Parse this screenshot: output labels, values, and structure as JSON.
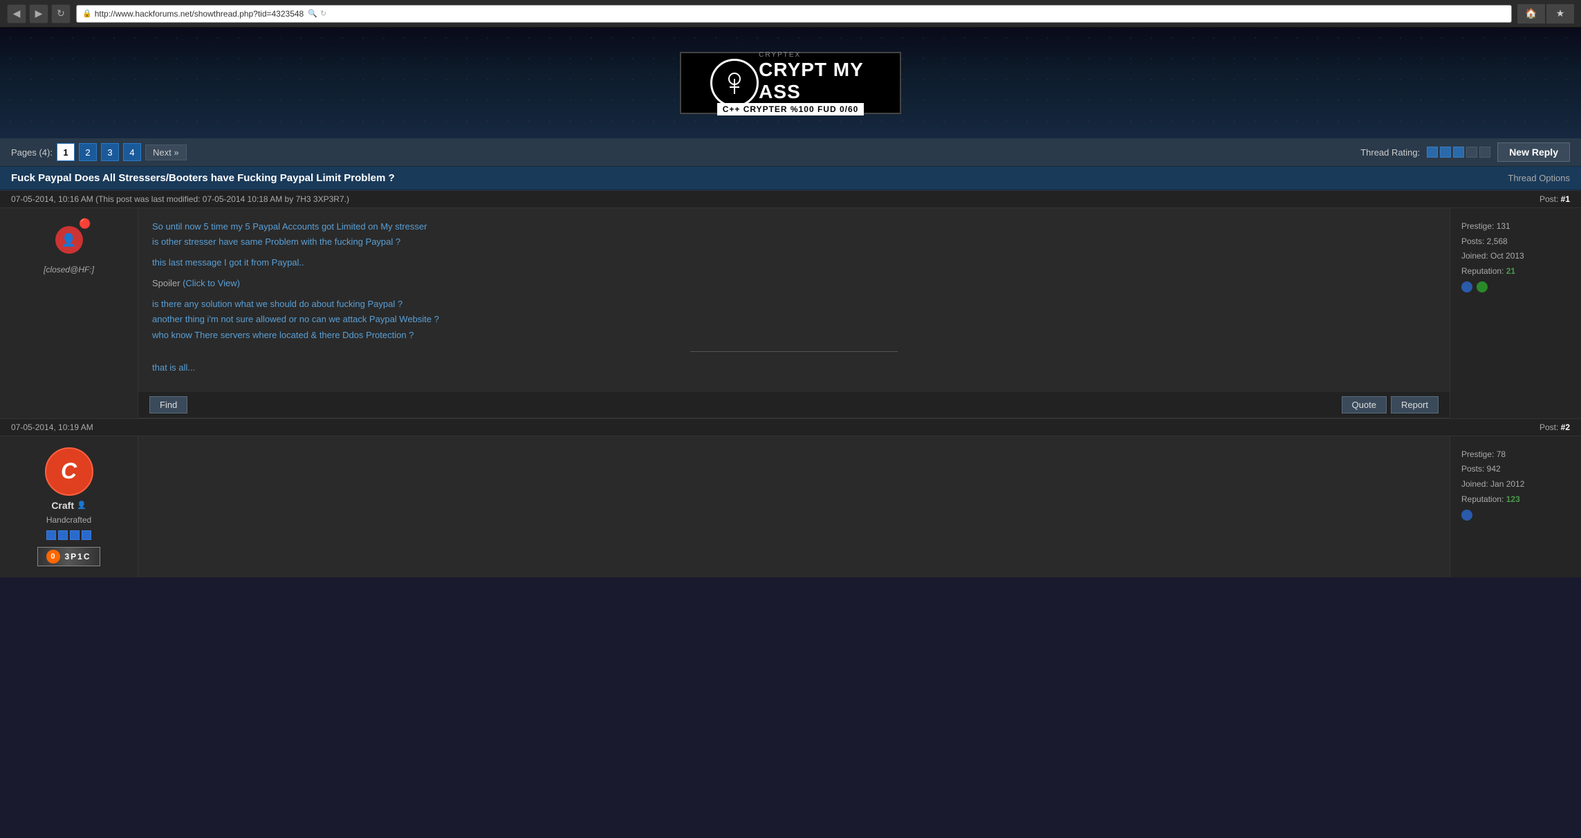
{
  "browser": {
    "url": "http://www.hackforums.net/showthread.php?tid=4323548",
    "home_icon": "🏠",
    "star_icon": "★",
    "refresh_icon": "↻",
    "back_icon": "◀",
    "forward_icon": "▶"
  },
  "banner": {
    "top_text": "CRYPTEX",
    "main_text": "CRYPT MY",
    "sub_text": "ASS",
    "bottom_text": "C++ CRYPTER  %100 FUD 0/60"
  },
  "thread_nav": {
    "pages_label": "Pages (4):",
    "pages": [
      "1",
      "2",
      "3",
      "4"
    ],
    "next_label": "Next »",
    "thread_rating_label": "Thread Rating:",
    "new_reply_label": "New Reply"
  },
  "thread": {
    "title": "Fuck Paypal Does All Stressers/Booters have Fucking Paypal Limit Problem ?",
    "options_label": "Thread Options"
  },
  "post1": {
    "timestamp": "07-05-2014, 10:16 AM (This post was last modified: 07-05-2014 10:18 AM by 7H3 3XP3R7.)",
    "post_num": "Post: #1",
    "username": "[closed@HF:]",
    "prestige": "Prestige: 131",
    "posts": "Posts: 2,568",
    "joined": "Joined: Oct 2013",
    "reputation_label": "Reputation:",
    "reputation_value": "21",
    "content_lines": [
      "So until now 5 time my 5 Paypal Accounts got Limited on My stresser",
      "is other stresser have same Problem with the fucking Paypal ?"
    ],
    "message_line": "this last message I got it from Paypal..",
    "spoiler_label": "Spoiler",
    "spoiler_click": "(Click to View)",
    "bottom_lines": [
      "is there any solution what we should do about fucking Paypal ?",
      "another thing i'm not sure allowed or no can we attack Paypal Website ?",
      "who know There servers where located & there Ddos Protection ?"
    ],
    "final_line": "that is all...",
    "find_btn": "Find",
    "quote_btn": "Quote",
    "report_btn": "Report"
  },
  "post2": {
    "timestamp": "07-05-2014, 10:19 AM",
    "post_num": "Post: #2",
    "username": "Craft",
    "rank": "Handcrafted",
    "prestige": "Prestige: 78",
    "posts": "Posts: 942",
    "joined": "Joined: Jan 2012",
    "reputation_label": "Reputation:",
    "reputation_value": "123",
    "epic_text": "3P1C",
    "avatar_letter": "C"
  }
}
